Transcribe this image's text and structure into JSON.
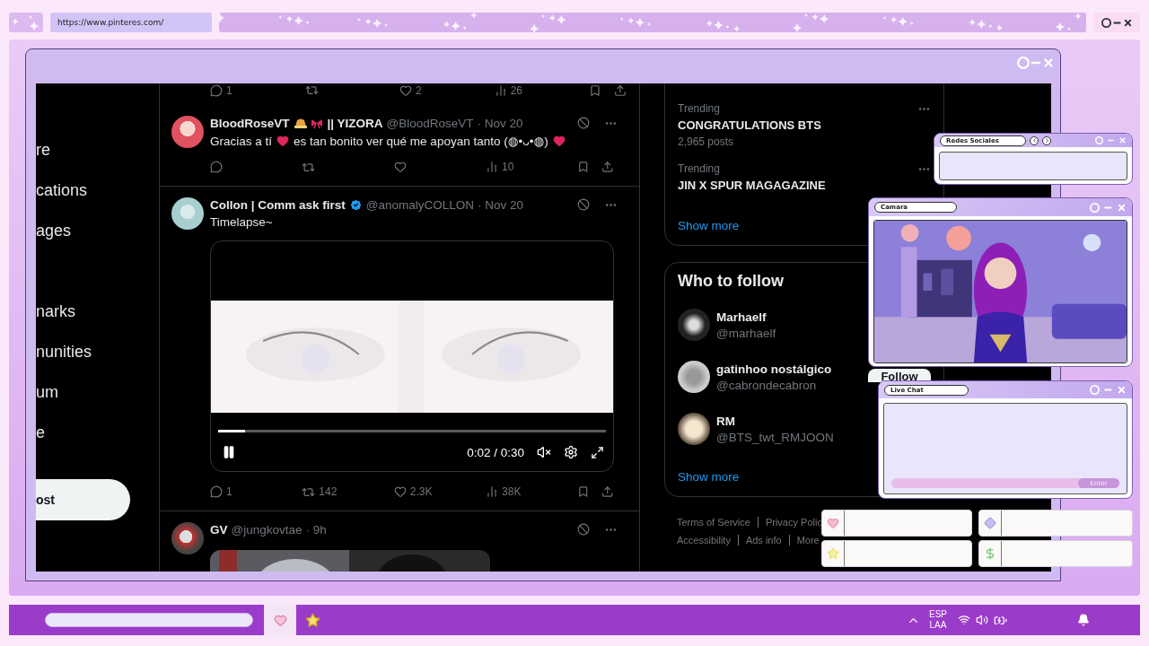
{
  "browser": {
    "url": "https://www.pinteres.com/"
  },
  "nav": {
    "items": [
      "re",
      "cations",
      "ages",
      "narks",
      "nunities",
      "um",
      "e"
    ],
    "post_button": "ost"
  },
  "feed": {
    "previous_actions": {
      "replies": "1",
      "likes": "2",
      "views": "26"
    },
    "posts": [
      {
        "kind": "text",
        "name": "BloodRoseVT",
        "emoji": true,
        "name_suffix": "|| YIZORA",
        "verified": false,
        "handle": "@BloodRoseVT",
        "time": "· Nov 20",
        "body": [
          {
            "kind": "text",
            "text": "Gracias a tí"
          },
          {
            "kind": "heart"
          },
          {
            "kind": "text",
            "text": "es tan bonito ver qué me apoyan tanto (◍•ᴗ•◍)"
          },
          {
            "kind": "heart"
          }
        ],
        "actions": {
          "views": "10"
        }
      },
      {
        "kind": "video",
        "name": "Collon | Comm ask first",
        "emoji": false,
        "verified": true,
        "handle": "@anomalyCOLLON",
        "time": "· Nov 20",
        "body": [
          {
            "kind": "text",
            "text": "Timelapse~"
          }
        ],
        "video": {
          "playing": true,
          "level": 0.07,
          "time": "0:02 / 0:30"
        },
        "actions": {
          "replies": "1",
          "reposts": "142",
          "likes": "2.3K",
          "views": "38K"
        }
      },
      {
        "name": "GV",
        "emoji": false,
        "verified": false,
        "handle": "@jungkovtae",
        "time": "· 9h"
      }
    ]
  },
  "trends": {
    "items": [
      {
        "label": "Trending",
        "title": "CONGRATULATIONS BTS",
        "posts": "2,965 posts"
      },
      {
        "label": "Trending",
        "title": "JIN X SPUR MAGAGAZINE"
      }
    ],
    "show_more": "Show more"
  },
  "who_to_follow": {
    "title": "Who to follow",
    "items": [
      {
        "name": "Marhaelf",
        "handle": "@marhaelf"
      },
      {
        "name": "gatinhoo nostálgico",
        "handle": "@cabrondecabron",
        "button": "Follow"
      },
      {
        "name": "RM",
        "handle": "@BTS_twt_RMJOON"
      }
    ],
    "show_more": "Show more"
  },
  "footer": {
    "rows": [
      [
        "Terms of Service",
        "Privacy Polic"
      ],
      [
        "Accessibility",
        "Ads info",
        "More"
      ]
    ]
  },
  "overlays": {
    "social": {
      "title": "Redes Sociales"
    },
    "camera": {
      "title": "Camara"
    },
    "chat": {
      "title": "Live Chat",
      "button": "Enter"
    }
  },
  "taskbar": {
    "language": [
      "ESP",
      "LAA"
    ]
  }
}
